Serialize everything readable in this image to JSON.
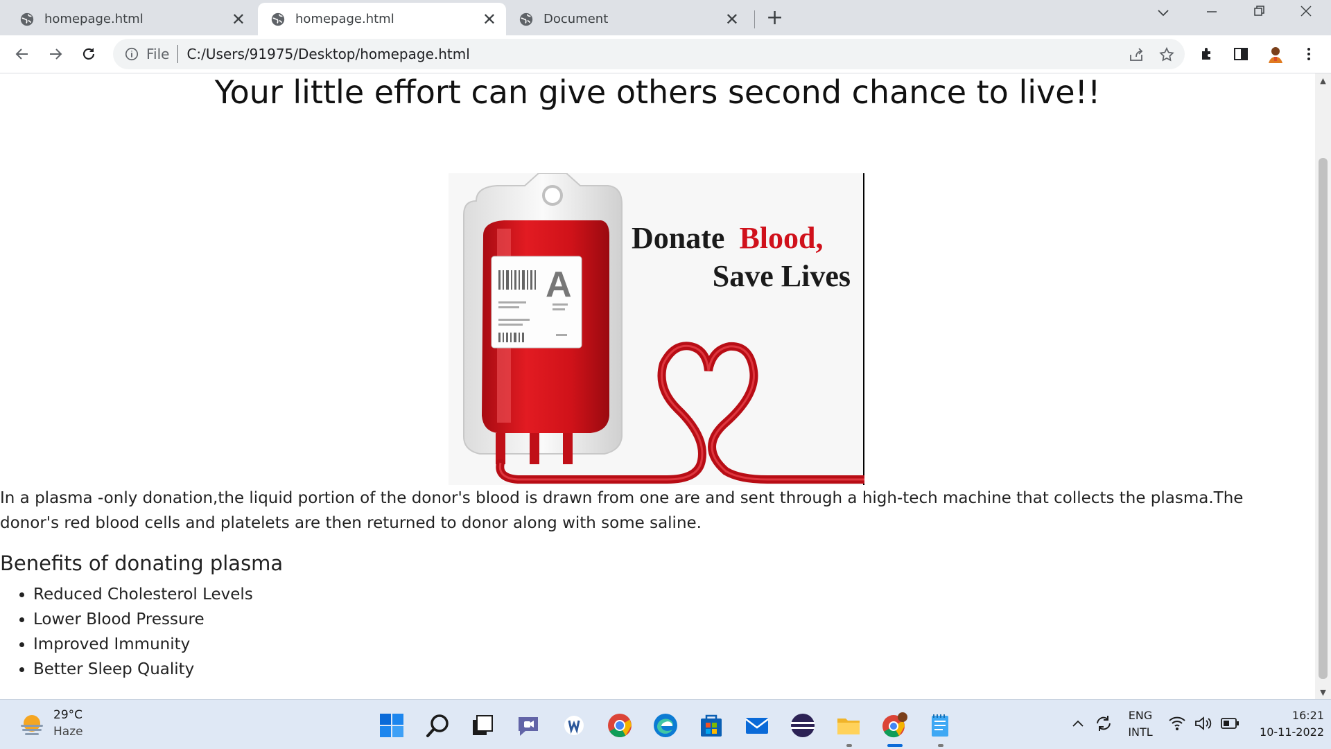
{
  "browser": {
    "tabs": [
      {
        "title": "homepage.html",
        "active": false
      },
      {
        "title": "homepage.html",
        "active": true
      },
      {
        "title": "Document",
        "active": false
      }
    ],
    "address": {
      "scheme_label": "File",
      "url": "C:/Users/91975/Desktop/homepage.html"
    }
  },
  "page": {
    "headline": "Your little effort can give others second chance to live!!",
    "hero_image": {
      "line1_dark": "Donate",
      "line1_red": "Blood,",
      "line2": "Save  Lives",
      "bag_letter": "A"
    },
    "intro": "In a plasma -only donation,the liquid portion of the donor's blood is drawn from one are and sent through a high-tech machine that collects the plasma.The donor's red blood cells and platelets are then returned to donor along with some saline.",
    "benefits_title": "Benefits of donating plasma",
    "benefits": [
      "Reduced Cholesterol Levels",
      "Lower Blood Pressure",
      "Improved Immunity",
      "Better Sleep Quality"
    ]
  },
  "taskbar": {
    "weather": {
      "temp": "29°C",
      "condition": "Haze"
    },
    "language": {
      "line1": "ENG",
      "line2": "INTL"
    },
    "clock": {
      "time": "16:21",
      "date": "10-11-2022"
    }
  },
  "colors": {
    "blood_red": "#d0111b",
    "tab_strip": "#dee1e6",
    "taskbar": "#dfe8f5"
  }
}
